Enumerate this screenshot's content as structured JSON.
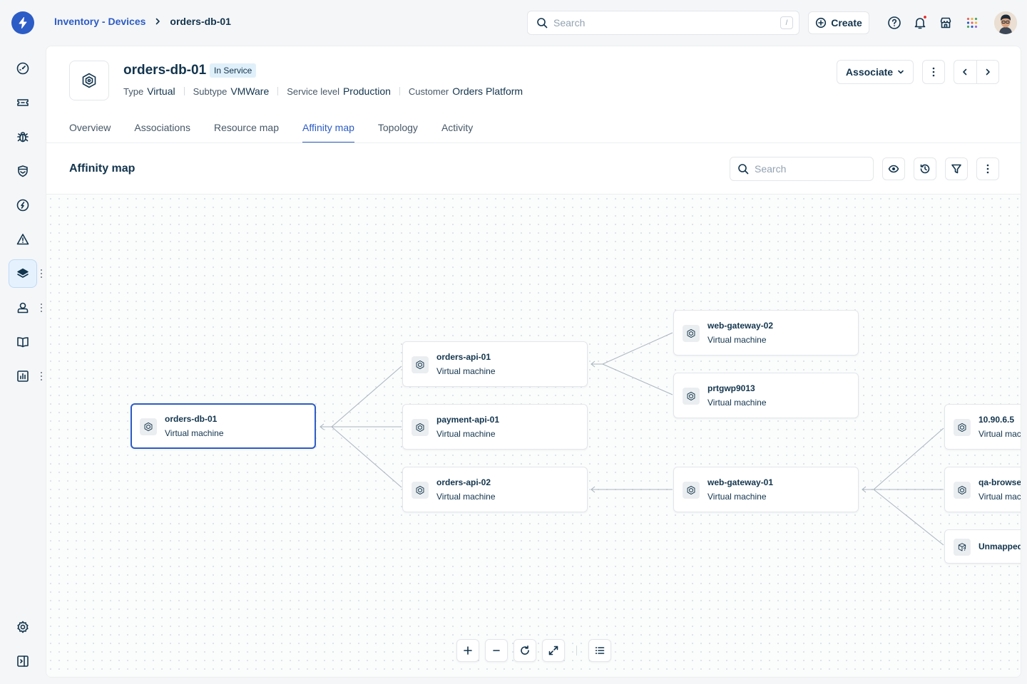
{
  "breadcrumb": {
    "parent": "Inventory - Devices",
    "current": "orders-db-01"
  },
  "global_search": {
    "placeholder": "Search",
    "shortcut": "/"
  },
  "create_label": "Create",
  "entity": {
    "name": "orders-db-01",
    "status": "In Service",
    "properties": [
      {
        "key": "Type",
        "value": "Virtual"
      },
      {
        "key": "Subtype",
        "value": "VMWare"
      },
      {
        "key": "Service level",
        "value": "Production"
      },
      {
        "key": "Customer",
        "value": "Orders Platform"
      }
    ]
  },
  "associate_label": "Associate",
  "tabs": [
    "Overview",
    "Associations",
    "Resource map",
    "Affinity map",
    "Topology",
    "Activity"
  ],
  "active_tab": "Affinity map",
  "panel": {
    "title": "Affinity map",
    "search_placeholder": "Search"
  },
  "nodes": [
    {
      "name": "orders-db-01",
      "type": "Virtual machine",
      "selected": true
    },
    {
      "name": "orders-api-01",
      "type": "Virtual machine"
    },
    {
      "name": "payment-api-01",
      "type": "Virtual machine"
    },
    {
      "name": "orders-api-02",
      "type": "Virtual machine"
    },
    {
      "name": "web-gateway-02",
      "type": "Virtual machine"
    },
    {
      "name": "prtgwp9013",
      "type": "Virtual machine"
    },
    {
      "name": "web-gateway-01",
      "type": "Virtual machine"
    },
    {
      "name": "10.90.6.5",
      "type": "Virtual machine"
    },
    {
      "name": "qa-browser",
      "type": "Virtual machine"
    },
    {
      "name": "Unmapped",
      "type": ""
    }
  ],
  "colors": {
    "accent": "#2c5cc5",
    "text": "#12344d",
    "edge": "#a9b5c0",
    "badge_bg": "#e0f0fa"
  },
  "icons": {
    "rail": [
      "dashboard-icon",
      "ticket-icon",
      "bug-icon",
      "shield-icon",
      "compass-icon",
      "alert-icon",
      "inventory-layers-icon",
      "contacts-icon",
      "book-icon",
      "reports-icon",
      "settings-icon",
      "collapse-sidebar-icon"
    ],
    "top": [
      "search-icon",
      "create-plus-icon",
      "help-icon",
      "bell-icon",
      "marketplace-icon",
      "apps-grid-icon"
    ],
    "canvas": [
      "zoom-in-icon",
      "zoom-out-icon",
      "reset-icon",
      "fullscreen-icon",
      "legend-list-icon"
    ]
  }
}
